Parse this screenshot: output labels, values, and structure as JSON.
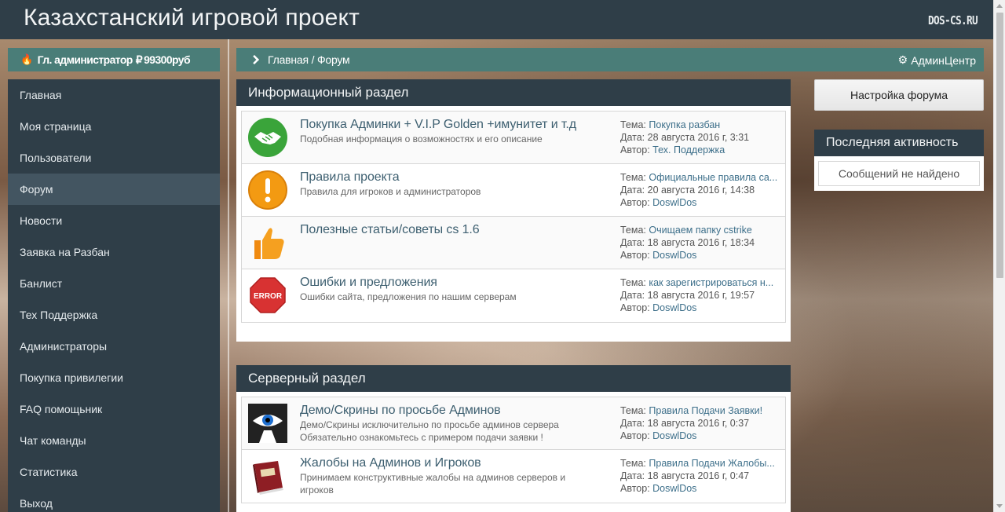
{
  "header": {
    "site_title": "Казахстанский игровой проект",
    "logo_text": "DOS-CS.RU"
  },
  "user_bar": {
    "role": "Гл. администратор",
    "balance": "99300руб"
  },
  "sidebar": {
    "items": [
      {
        "label": "Главная",
        "active": false
      },
      {
        "label": "Моя страница",
        "active": false
      },
      {
        "label": "Пользователи",
        "active": false
      },
      {
        "label": "Форум",
        "active": true
      },
      {
        "label": "Новости",
        "active": false
      },
      {
        "label": "Заявка на Разбан",
        "active": false
      },
      {
        "label": "Банлист",
        "active": false
      },
      {
        "label": "Тех Поддержка",
        "active": false
      },
      {
        "label": "Администраторы",
        "active": false
      },
      {
        "label": "Покупка привилегии",
        "active": false
      },
      {
        "label": "FAQ помощьник",
        "active": false
      },
      {
        "label": "Чат команды",
        "active": false
      },
      {
        "label": "Статистика",
        "active": false
      },
      {
        "label": "Выход",
        "active": false
      }
    ]
  },
  "breadcrumb": {
    "text": "Главная / Форум",
    "admin_link": "АдминЦентр"
  },
  "meta_labels": {
    "topic": "Тема:",
    "date": "Дата:",
    "author": "Автор:"
  },
  "sections": [
    {
      "title": "Информационный раздел",
      "forums": [
        {
          "icon": "handshake-icon",
          "title": "Покупка Админки + V.I.P Golden +имунитет и т.д",
          "desc": "Подобная информация о возможностях и его описание",
          "topic": "Покупка разбан",
          "date": "28 августа 2016 г, 3:31",
          "author": "Тех. Поддержка"
        },
        {
          "icon": "exclamation-icon",
          "title": "Правила проекта",
          "desc": "Правила для игроков и администраторов",
          "topic": "Официальные правила са...",
          "date": "20 августа 2016 г, 14:38",
          "author": "DoswlDos"
        },
        {
          "icon": "thumbs-up-icon",
          "title": "Полезные статьи/советы cs 1.6",
          "desc": "",
          "topic": "Очищаем папку cstrike",
          "date": "18 августа 2016 г, 18:34",
          "author": "DoswlDos"
        },
        {
          "icon": "error-stop-icon",
          "title": "Ошибки и предложения",
          "desc": "Ошибки сайта, предложения по нашим серверам",
          "topic": "как зарегистрироваться н...",
          "date": "18 августа 2016 г, 19:57",
          "author": "DoswlDos"
        }
      ]
    },
    {
      "title": "Серверный раздел",
      "forums": [
        {
          "icon": "eye-icon",
          "title": "Демо/Скрины по просьбе Админов",
          "desc": "Демо/Скрины исключительно по просьбе админов сервера Обязательно ознакомьтесь с примером подачи заявки !",
          "topic": "Правила Подачи Заявки!",
          "date": "18 августа 2016 г, 0:37",
          "author": "DoswlDos"
        },
        {
          "icon": "book-icon",
          "title": "Жалобы на Админов и Игроков",
          "desc": "Принимаем конструктивные жалобы на админов серверов и игроков",
          "topic": "Правила Подачи Жалобы...",
          "date": "18 августа 2016 г, 0:47",
          "author": "DoswlDos"
        }
      ]
    }
  ],
  "right": {
    "settings_button": "Настройка форума",
    "activity_title": "Последняя активность",
    "activity_empty": "Сообщений не найдено"
  }
}
